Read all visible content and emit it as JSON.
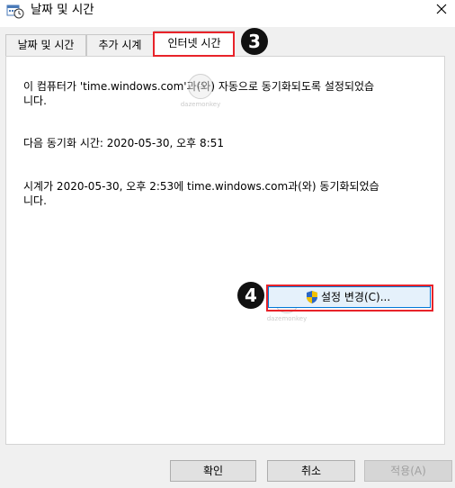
{
  "window": {
    "title": "날짜 및 시간"
  },
  "tabs": [
    {
      "label": "날짜 및 시간"
    },
    {
      "label": "추가 시계"
    },
    {
      "label": "인터넷 시간"
    }
  ],
  "badges": {
    "step3": "3",
    "step4": "4"
  },
  "content": {
    "line1": "이 컴퓨터가 'time.windows.com'과(와) 자동으로 동기화되도록 설정되었습",
    "line1b": "니다.",
    "line2": "다음 동기화 시간: 2020-05-30, 오후 8:51",
    "line3": "시계가 2020-05-30, 오후 2:53에 time.windows.com과(와) 동기화되었습",
    "line3b": "니다."
  },
  "change_settings_button": "설정 변경(C)...",
  "footer": {
    "ok": "확인",
    "cancel": "취소",
    "apply": "적용(A)"
  },
  "watermark": {
    "text": "dazemonkey"
  },
  "colors": {
    "highlight": "#e8232a",
    "button_focus": "#0078d7"
  },
  "icons": {
    "window": "calendar-clock-icon",
    "close": "close-icon",
    "shield": "uac-shield-icon"
  }
}
